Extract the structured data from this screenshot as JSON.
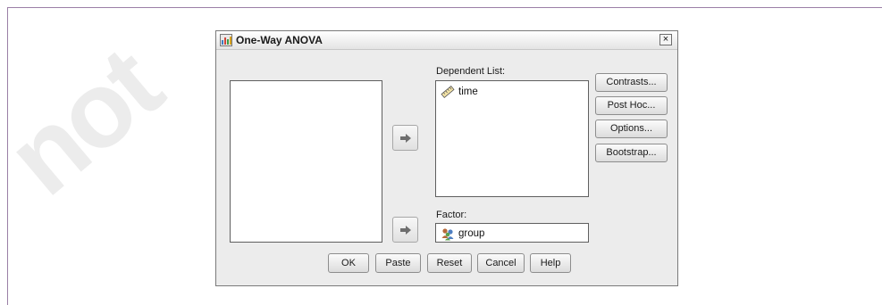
{
  "dialog": {
    "title": "One-Way ANOVA",
    "close_glyph": "×"
  },
  "dependent_list": {
    "label": "Dependent List:",
    "items": [
      {
        "name": "time",
        "icon": "scale-variable-icon"
      }
    ]
  },
  "factor": {
    "label": "Factor:",
    "value": "group",
    "icon": "nominal-variable-icon"
  },
  "side_buttons": {
    "contrasts": "Contrasts...",
    "post_hoc": "Post Hoc...",
    "options": "Options...",
    "bootstrap": "Bootstrap..."
  },
  "bottom_buttons": {
    "ok": "OK",
    "paste": "Paste",
    "reset": "Reset",
    "cancel": "Cancel",
    "help": "Help"
  },
  "watermark_text": "not"
}
